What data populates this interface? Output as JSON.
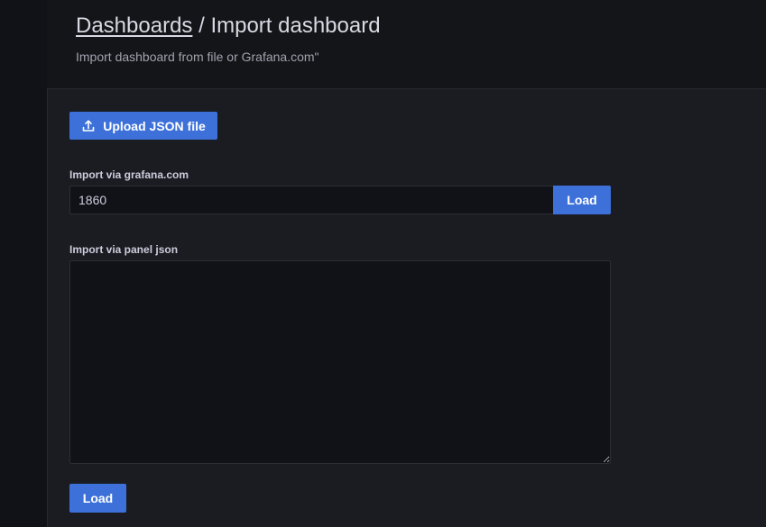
{
  "header": {
    "breadcrumb_link": "Dashboards",
    "breadcrumb_separator": " / ",
    "page_title": "Import dashboard",
    "subtitle": "Import dashboard from file or Grafana.com\""
  },
  "upload": {
    "label": "Upload JSON file",
    "icon": "upload-icon"
  },
  "grafana_com": {
    "label": "Import via grafana.com",
    "value": "1860",
    "load_label": "Load"
  },
  "panel_json": {
    "label": "Import via panel json",
    "value": ""
  },
  "footer": {
    "load_label": "Load"
  },
  "colors": {
    "primary": "#3d71d9",
    "background": "#111217",
    "panel": "#1a1c21"
  }
}
